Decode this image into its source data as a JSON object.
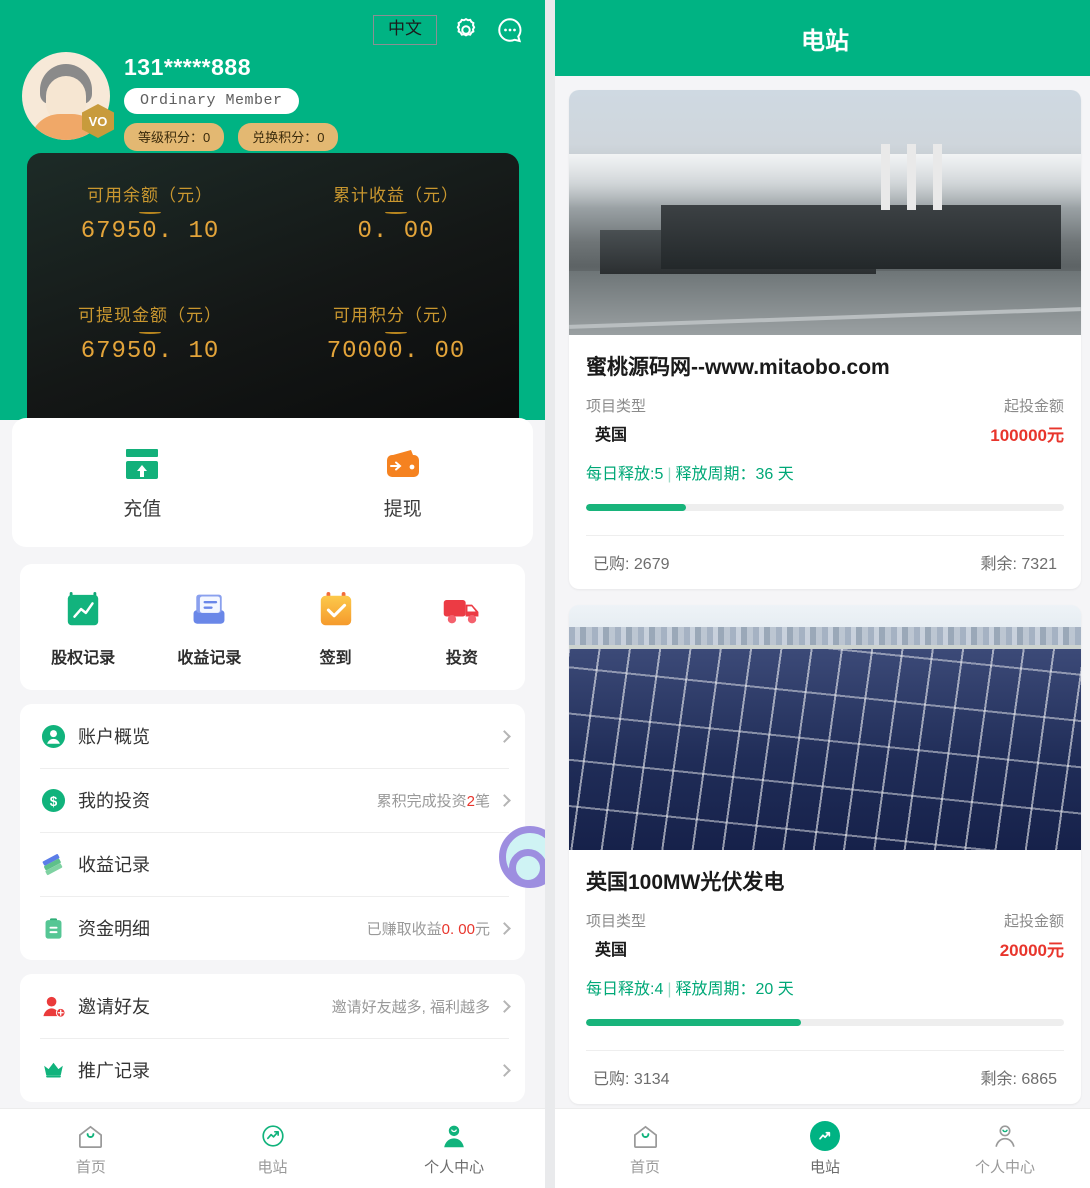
{
  "left": {
    "header": {
      "lang_button": "中文",
      "settings_icon": "gear-icon",
      "message_icon": "chat-dots-icon",
      "phone": "131*****888",
      "member_label": "Ordinary Member",
      "level_badge": "VO",
      "pills": [
        {
          "label": "等级积分：0"
        },
        {
          "label": "兑换积分：0"
        }
      ]
    },
    "balance": [
      {
        "label": "可用余额（元）",
        "value": "67950. 10"
      },
      {
        "label": "累计收益（元）",
        "value": "0. 00"
      },
      {
        "label": "可提现金额（元）",
        "value": "67950. 10"
      },
      {
        "label": "可用积分（元）",
        "value": "70000. 00"
      }
    ],
    "actions": [
      {
        "label": "充值",
        "icon": "recharge-card-icon"
      },
      {
        "label": "提现",
        "icon": "withdraw-wallet-icon"
      }
    ],
    "grid": [
      {
        "label": "股权记录",
        "icon": "equity-chart-icon"
      },
      {
        "label": "收益记录",
        "icon": "earnings-book-icon"
      },
      {
        "label": "签到",
        "icon": "checkin-calendar-icon"
      },
      {
        "label": "投资",
        "icon": "invest-truck-icon"
      }
    ],
    "menu_a": [
      {
        "label": "账户概览",
        "icon": "account-user-icon",
        "right": "",
        "right_num": "",
        "right_suffix": ""
      },
      {
        "label": "我的投资",
        "icon": "money-dollar-icon",
        "right": "累积完成投资",
        "right_num": "2",
        "right_suffix": "笔"
      },
      {
        "label": "收益记录",
        "icon": "earnings-bills-icon",
        "right": "",
        "right_num": "",
        "right_suffix": ""
      },
      {
        "label": "资金明细",
        "icon": "funds-clipboard-icon",
        "right": "已赚取收益",
        "right_num": "0. 00",
        "right_suffix": "元"
      }
    ],
    "menu_b": [
      {
        "label": "邀请好友",
        "icon": "invite-friend-icon",
        "right": "邀请好友越多, 福利越多",
        "right_num": "",
        "right_suffix": ""
      },
      {
        "label": "推广记录",
        "icon": "promotion-crown-icon",
        "right": "",
        "right_num": "",
        "right_suffix": ""
      }
    ],
    "tabs": [
      {
        "label": "首页",
        "icon": "home-icon",
        "active": false
      },
      {
        "label": "电站",
        "icon": "power-station-icon",
        "active": false
      },
      {
        "label": "个人中心",
        "icon": "profile-icon",
        "active": true
      }
    ]
  },
  "right": {
    "title": "电站",
    "labels": {
      "type_label": "项目类型",
      "min_label": "起投金额",
      "daily_prefix": "每日释放:",
      "cycle_prefix": "释放周期：",
      "cycle_unit": "天",
      "bought_prefix": "已购: ",
      "remain_prefix": "剩余: "
    },
    "projects": [
      {
        "image": "power-plant-photo",
        "title": "蜜桃源码网--www.mitaobo.com",
        "type": "英国",
        "min_amount": "100000元",
        "daily_release": "5",
        "cycle_days": "36",
        "progress_pct": 21,
        "bought": "2679",
        "remaining": "7321"
      },
      {
        "image": "solar-farm-photo",
        "title": "英国100MW光伏发电",
        "type": "英国",
        "min_amount": "20000元",
        "daily_release": "4",
        "cycle_days": "20",
        "progress_pct": 45,
        "bought": "3134",
        "remaining": "6865"
      }
    ],
    "tabs": [
      {
        "label": "首页",
        "icon": "home-icon",
        "active": false
      },
      {
        "label": "电站",
        "icon": "power-station-icon",
        "active": true
      },
      {
        "label": "个人中心",
        "icon": "profile-icon",
        "active": false
      }
    ]
  },
  "colors": {
    "brand_green": "#00b383",
    "accent_gold": "#e3a43a",
    "danger_red": "#e8352c",
    "progress_green": "#18b47b"
  }
}
